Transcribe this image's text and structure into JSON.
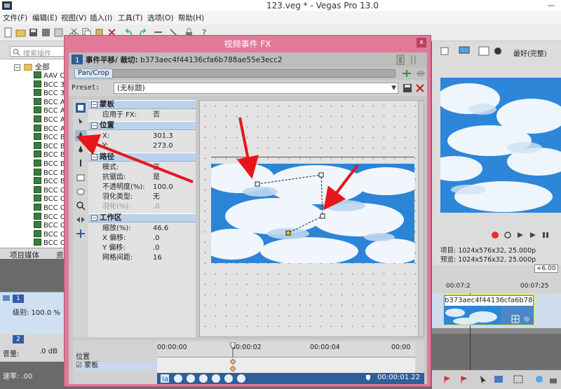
{
  "window": {
    "title": "123.veg * - Vegas Pro 13.0",
    "minimize": "—",
    "maximize": "☐"
  },
  "menu": {
    "items": [
      "文件(F)",
      "编辑(E)",
      "视图(V)",
      "插入(I)",
      "工具(T)",
      "选项(O)",
      "帮助(H)"
    ]
  },
  "explorer": {
    "search_placeholder": "搜索插件",
    "root_label": "全部",
    "items": [
      "AAV C",
      "BCC 3",
      "BCC 3",
      "BCC A",
      "BCC A",
      "BCC A",
      "BCC A",
      "BCC B",
      "BCC B",
      "BCC B",
      "BCC B",
      "BCC B",
      "BCC B",
      "BCC C",
      "BCC C",
      "BCC C",
      "BCC C",
      "BCC C",
      "BCC C",
      "BCC C"
    ],
    "tabs": [
      "项目媒体",
      "资"
    ]
  },
  "tracks": {
    "track1_num": "1",
    "track1_level": "级别: 100.0 %",
    "track2_num": "2",
    "track2_volume": "音量:",
    "track2_db": ".0 dB",
    "rate": "速率: .00"
  },
  "preview": {
    "quality": "最好(完整)",
    "project_info": "项目: 1024x576x32, 25.000p",
    "preview_info": "预览: 1024x576x32, 25.000p",
    "zoom_badge": "+6.00",
    "ruler_t1": "00:07:2",
    "ruler_t2": "00:07:25",
    "clip_label": "b373aec4f44136cfa6b788ae"
  },
  "fx_dialog": {
    "title": "视频事件 FX",
    "close": "x",
    "chain_label": "事件平移/ 裁切:",
    "chain_value": "b373aec4f44136cfa6b788ae55e3ecc2",
    "plugin_tab": "Pan/Crop",
    "preset_label": "Preset:",
    "preset_value": "(无标题)",
    "sections": {
      "mask": {
        "title": "蒙板",
        "rows": [
          {
            "k": "应用于 FX:",
            "v": "否"
          }
        ]
      },
      "position": {
        "title": "位置",
        "rows": [
          {
            "k": "X:",
            "v": "301.3"
          },
          {
            "k": "Y:",
            "v": "273.0"
          }
        ]
      },
      "path": {
        "title": "路径",
        "rows": [
          {
            "k": "模式:",
            "v": "正"
          },
          {
            "k": "抗锯齿:",
            "v": "是"
          },
          {
            "k": "不透明度(%):",
            "v": "100.0"
          },
          {
            "k": "羽化类型:",
            "v": "无"
          },
          {
            "k": "羽化(%):",
            "v": ".0"
          }
        ]
      },
      "workspace": {
        "title": "工作区",
        "rows": [
          {
            "k": "缩放(%):",
            "v": "46.6"
          },
          {
            "k": "X 偏移:",
            "v": ".0"
          },
          {
            "k": "Y 偏移:",
            "v": ".0"
          },
          {
            "k": "网格间距:",
            "v": "16"
          }
        ]
      }
    },
    "keyframes": {
      "label_position": "位置",
      "label_mask": "蒙板",
      "t0": "00:00:00",
      "t1": "00:00:02",
      "t2": "00:00:04",
      "t3": "00:00",
      "current_time": "00:00:01.22"
    }
  },
  "colors": {
    "dialog_frame": "#e07a98",
    "section_header": "#bcd2ec",
    "annotation": "#e8161b",
    "timeline_bar": "#2d5f99"
  }
}
